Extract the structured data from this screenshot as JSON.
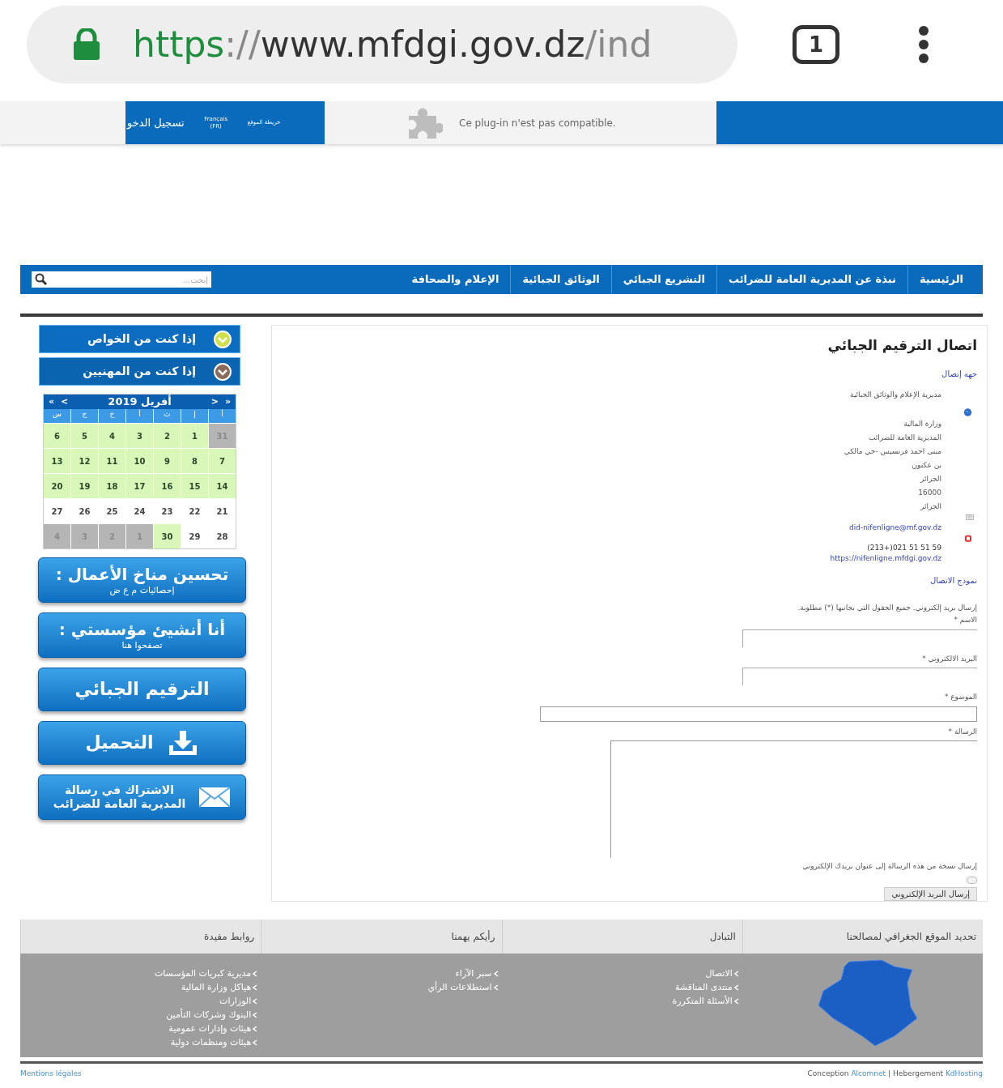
{
  "browser": {
    "url": {
      "scheme": "https",
      "separator": "://",
      "host": "www.mfdgi.gov.dz",
      "path": "/ind"
    },
    "tab_count": "1"
  },
  "top_strip": {
    "login": "تسجيل الدخو",
    "language": "Français (FR)",
    "sitemap": "خريطة الموقع",
    "plugin_message": "Ce plug-in n'est pas compatible."
  },
  "nav": {
    "items": [
      "الرئيسية",
      "نبذة عن المديرية العامة للضرائب",
      "التشريع الجبائي",
      "الوثائق الجبائية",
      "الإعلام والصحافة"
    ],
    "search": {
      "placeholder": "إبحث..."
    }
  },
  "sidebar": {
    "accordions": [
      {
        "label": "إذا كنت من الخواص",
        "selected": true
      },
      {
        "label": "إذا كنت من المهنيين",
        "selected": false
      }
    ],
    "calendar": {
      "title": "أفريل 2019",
      "nav": {
        "first": "«",
        "previous": "<",
        "next": ">",
        "last": "»"
      },
      "weekdays": [
        "أ",
        "إ",
        "ث",
        "أ",
        "خ",
        "ج",
        "س"
      ],
      "days": [
        {
          "day": "31",
          "kind": "outside"
        },
        {
          "day": "1",
          "kind": "marked"
        },
        {
          "day": "2",
          "kind": "marked"
        },
        {
          "day": "3",
          "kind": "marked"
        },
        {
          "day": "4",
          "kind": "marked"
        },
        {
          "day": "5",
          "kind": "marked"
        },
        {
          "day": "6",
          "kind": "marked"
        },
        {
          "day": "7",
          "kind": "marked"
        },
        {
          "day": "8",
          "kind": "marked"
        },
        {
          "day": "9",
          "kind": "marked"
        },
        {
          "day": "10",
          "kind": "marked"
        },
        {
          "day": "11",
          "kind": "marked"
        },
        {
          "day": "12",
          "kind": "marked"
        },
        {
          "day": "13",
          "kind": "marked"
        },
        {
          "day": "14",
          "kind": "marked"
        },
        {
          "day": "15",
          "kind": "marked"
        },
        {
          "day": "16",
          "kind": "marked"
        },
        {
          "day": "17",
          "kind": "marked"
        },
        {
          "day": "18",
          "kind": "marked"
        },
        {
          "day": "19",
          "kind": "marked"
        },
        {
          "day": "20",
          "kind": "marked"
        },
        {
          "day": "21",
          "kind": "normal"
        },
        {
          "day": "22",
          "kind": "normal"
        },
        {
          "day": "23",
          "kind": "normal"
        },
        {
          "day": "24",
          "kind": "normal"
        },
        {
          "day": "25",
          "kind": "normal"
        },
        {
          "day": "26",
          "kind": "normal"
        },
        {
          "day": "27",
          "kind": "normal"
        },
        {
          "day": "28",
          "kind": "normal"
        },
        {
          "day": "29",
          "kind": "normal"
        },
        {
          "day": "30",
          "kind": "marked"
        },
        {
          "day": "1",
          "kind": "outside"
        },
        {
          "day": "2",
          "kind": "outside"
        },
        {
          "day": "3",
          "kind": "outside"
        },
        {
          "day": "4",
          "kind": "outside"
        }
      ]
    },
    "buttons": [
      {
        "kind": "titled",
        "title": "تحسين مناخ الأعمال :",
        "subtitle": "إحصائيات م ع ض"
      },
      {
        "kind": "titled",
        "title": "أنا أنشيئ مؤسستي :",
        "subtitle": "تصفحوا هنا"
      },
      {
        "kind": "plain",
        "title": "الترقيم الجبائي"
      },
      {
        "kind": "download",
        "title": "التحميل"
      },
      {
        "kind": "mail",
        "title": "الاشتراك في رسالة",
        "subtitle": "المديرية العامة للضرائب"
      }
    ]
  },
  "contact": {
    "title": "اتصال الترقيم الجبائي",
    "section": "جهة إتصال",
    "department": "مديرية الإعلام والوثائق الجبائية",
    "address": [
      "وزارة المالية",
      "المديرية العامة للضرائب",
      "مبنى احمد فرنسيس -حي مالكي",
      "بن عكنون",
      "الجزائر",
      "16000",
      "الجزائر"
    ],
    "email": "did-nifenligne@mf.gov.dz",
    "phone": "(213+)021 51 51 59",
    "website": "https://nifenligne.mfdgi.gov.dz",
    "form": {
      "title": "نموذج الاتصال",
      "note": "إرسال بريد إلكتروني. جميع الحقول التي بجانبها (*) مطلوبة.",
      "fields": [
        {
          "label": "الاسم *",
          "kind": "short"
        },
        {
          "label": "البريد الالكتروني *",
          "kind": "short"
        },
        {
          "label": "الموضوع *",
          "kind": "wide"
        },
        {
          "label": "الرسالة *",
          "kind": "textarea"
        }
      ],
      "copy": {
        "label": "إرسال نسخة من هذه الرسالة إلى عنوان بريدك الإلكتروني",
        "checked": false
      },
      "submit": "إرسال البريد الإلكتروني"
    }
  },
  "footer": {
    "columns": [
      {
        "title": "تحديد الموقع الجغرافي لمصالحنا",
        "kind": "map"
      },
      {
        "title": "التبادل",
        "kind": "links",
        "links": [
          "الاتصال",
          "منتدى المناقشة",
          "الأسئلة المتكررة"
        ]
      },
      {
        "title": "رأيكم يهمنا",
        "kind": "links",
        "links": [
          "سبر الآراء",
          "استطلاعات الرأي"
        ]
      },
      {
        "title": "روابط مفيدة",
        "kind": "links",
        "links": [
          "مديرية كبريات المؤسسات",
          "هياكل وزارة المالية",
          "الوزارات",
          "البنوك وشركات التأمين",
          "هيئات وإدارات عمومية",
          "هيئات ومنظمات دولية"
        ]
      }
    ],
    "legal": "Mentions légales",
    "credits": {
      "design_label": "Conception",
      "designer": "Alcomnet",
      "separator": "|",
      "hosting_label": "Hebergement",
      "host": "KdHosting"
    }
  }
}
